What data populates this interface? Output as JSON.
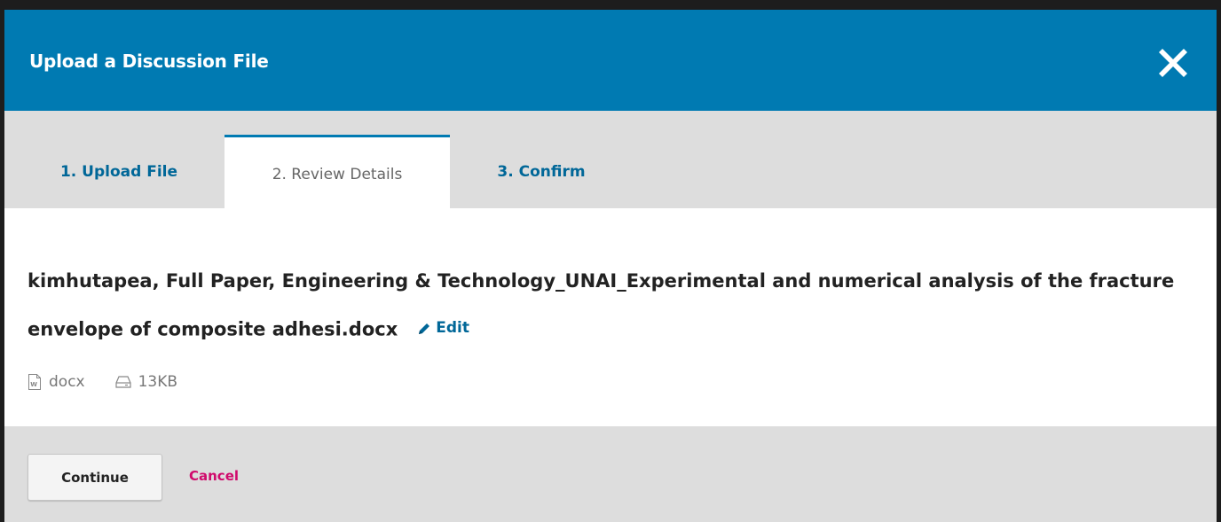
{
  "dialog": {
    "title": "Upload a Discussion File",
    "close_icon": "close-icon",
    "accent_color": "#007ab2"
  },
  "tabs": [
    {
      "label": "1. Upload File",
      "active": false
    },
    {
      "label": "2. Review Details",
      "active": true
    },
    {
      "label": "3. Confirm",
      "active": false
    }
  ],
  "file": {
    "name": "kimhutapea, Full Paper, Engineering & Technology_UNAI_Experimental and numerical analysis of the fracture envelope of composite adhesi.docx",
    "edit_label": "Edit",
    "edit_icon": "pencil-icon",
    "type": "docx",
    "type_icon": "word-file-icon",
    "size": "13KB",
    "size_icon": "hard-drive-icon"
  },
  "footer": {
    "continue_label": "Continue",
    "cancel_label": "Cancel",
    "cancel_color": "#d00a6c"
  }
}
